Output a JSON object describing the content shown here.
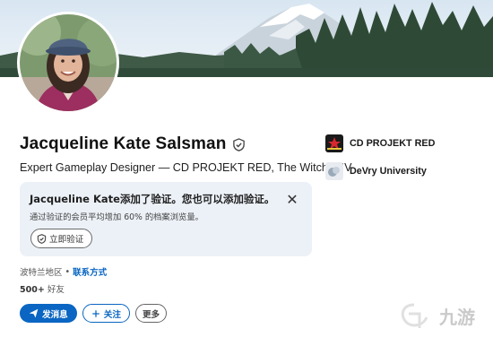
{
  "profile": {
    "name": "Jacqueline Kate Salsman",
    "headline": "Expert Gameplay Designer — CD PROJEKT RED, The Witcher IV",
    "location": "波特兰地区",
    "separator": "•",
    "contact_info": "联系方式",
    "connections_count": "500+",
    "connections_label": "好友"
  },
  "verify_card": {
    "title": "Jacqueline Kate添加了验证。您也可以添加验证。",
    "subtitle": "通过验证的会员平均增加 60% 的档案浏览量。",
    "button_label": "立即验证",
    "close_symbol": "✕"
  },
  "actions": {
    "message_label": "发消息",
    "follow_label": "关注",
    "more_label": "更多"
  },
  "organizations": [
    {
      "name": "CD PROJEKT RED",
      "logo": "cdpr-logo"
    },
    {
      "name": "DeVry University",
      "logo": "devry-logo"
    }
  ],
  "watermark": {
    "text": "九游"
  },
  "colors": {
    "accent": "#0a66c2",
    "card_bg": "#ecf1f7"
  }
}
